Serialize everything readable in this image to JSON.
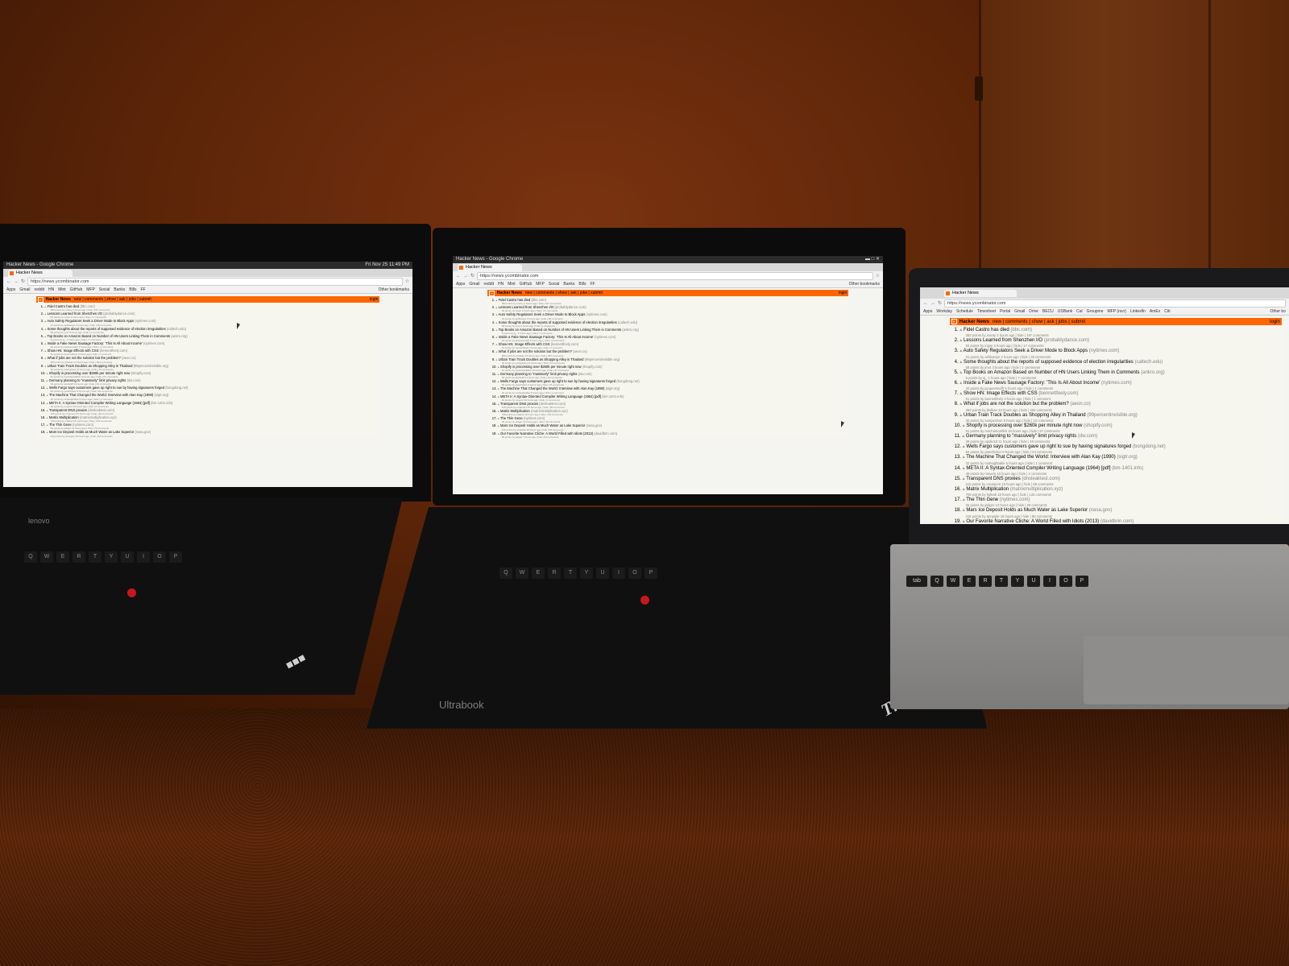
{
  "left_laptop": {
    "os_title": "Hacker News - Google Chrome",
    "os_clock": "Fri Nov 25 11:49 PM",
    "tab_title": "Hacker News",
    "url": "https://news.ycombinator.com",
    "bookmarks": [
      "Apps",
      "Gmail",
      "reddit",
      "HN",
      "Mint",
      "GitHub",
      "MFP",
      "Social",
      "Banks",
      "Bills",
      "FF"
    ],
    "other_bookmarks": "Other bookmarks",
    "brand": "lenovo"
  },
  "center_laptop": {
    "os_title": "Hacker News - Google Chrome",
    "tab_title": "Hacker News",
    "url": "https://news.ycombinator.com",
    "bookmarks": [
      "Apps",
      "Gmail",
      "reddit",
      "HN",
      "Mint",
      "GitHub",
      "MFP",
      "Social",
      "Banks",
      "Bills",
      "FF"
    ],
    "other_bookmarks": "Other bookmarks",
    "brand_badge": "Ultrabook",
    "logo": "ThinkPad"
  },
  "right_laptop": {
    "tab_title": "Hacker News",
    "url": "https://news.ycombinator.com",
    "bookmarks": [
      "Apps",
      "Workday",
      "Schedule",
      "Timesheet",
      "Portal",
      "Gmail",
      "Drive",
      "BECU",
      "USBank",
      "Cal",
      "Groupme",
      "MFP (rsvr)",
      "LinkedIn",
      "AmEx",
      "Citi"
    ],
    "other_bookmarks": "Other bo"
  },
  "hn": {
    "title": "Hacker News",
    "nav": "new | comments | show | ask | jobs | submit",
    "login": "login",
    "stories": [
      {
        "rank": "1.",
        "title": "Fidel Castro has died",
        "site": "(bbc.com)",
        "sub": "383 points by manty 2 hours ago | hide | 197 comments"
      },
      {
        "rank": "2.",
        "title": "Lessons Learned from Shenzhen I/O",
        "site": "(probablydance.com)",
        "sub": "93 points by ingve 3 hours ago | hide | 17 comments"
      },
      {
        "rank": "3.",
        "title": "Auto Safety Regulators Seek a Driver Mode to Block Apps",
        "site": "(nytimes.com)",
        "sub": "31 points by ashkaniye 3 hours ago | hide | 38 comments"
      },
      {
        "rank": "4.",
        "title": "Some thoughts about the reports of supposed evidence of election irregularities",
        "site": "(caltech.edu)",
        "sub": "58 points by jmut 3 hours ago | hide | 2 comments"
      },
      {
        "rank": "5.",
        "title": "Top Books on Amazon Based on Number of HN Users Linking Them in Comments",
        "site": "(ankro.org)",
        "sub": "5 points by sj_ 1 hours ago | hide | 7 comments"
      },
      {
        "rank": "6.",
        "title": "Inside a Fake News Sausage Factory: 'This Is All About Income'",
        "site": "(nytimes.com)",
        "sub": "32 points by jacquesmaffr 5 hours ago | hide | 4 comments"
      },
      {
        "rank": "7.",
        "title": "Show HN: Image Effects with CSS",
        "site": "(bennettfeely.com)",
        "sub": "51 points by bennettfeely 3 hours ago | hide | 1 comment"
      },
      {
        "rank": "8.",
        "title": "What if jobs are not the solution but the problem?",
        "site": "(aeon.co)",
        "sub": "383 points by jbelkan 13 hours ago | hide | 484 comments"
      },
      {
        "rank": "9.",
        "title": "Urban Train Track Doubles as Shopping Alley in Thailand",
        "site": "(99percentinvisible.org)",
        "sub": "30 points by samjackson 8 hours ago | hide | 10 comments"
      },
      {
        "rank": "10.",
        "title": "Shopify is processing over $260k per minute right now",
        "site": "(shopify.com)",
        "sub": "81 points by mechanicalfish 10 hours ago | hide | 57 comments"
      },
      {
        "rank": "11.",
        "title": "Germany planning to \"massively\" limit privacy rights",
        "site": "(dw.com)",
        "sub": "39 points by apollo18 11 hours ago | hide | 49 comments"
      },
      {
        "rank": "12.",
        "title": "Wells Fargo says customers gave up right to sue by having signatures forged",
        "site": "(bongdong.net)",
        "sub": "84 points by peterhicker 9 hours ago | hide | 24 comments"
      },
      {
        "rank": "13.",
        "title": "The Machine That Changed the World: Interview with Alan Kay (1990)",
        "site": "(sigtr.org)",
        "sub": "32 points by mobeightable 5 hours ago | hide | 1 comment"
      },
      {
        "rank": "14.",
        "title": "META II: A Syntax-Oriented Compiler Writing Language (1964) [pdf]",
        "site": "(bm-1401.info)",
        "sub": "49 points by meyers 10 hours ago | hide | 2 comments"
      },
      {
        "rank": "15.",
        "title": "Transparent DNS proxies",
        "site": "(dnsleaktest.com)",
        "sub": "115 points by ornament 15 hours ago | hide | 68 comments"
      },
      {
        "rank": "16.",
        "title": "Matrix Multiplication",
        "site": "(matrixmultiplication.xyz)",
        "sub": "708 points by haltedi 18 hours ago | hide | 133 comments"
      },
      {
        "rank": "17.",
        "title": "The Thin Gene",
        "site": "(nytimes.com)",
        "sub": "35 points by jwilger 13 hours ago | hide | 29 comments"
      },
      {
        "rank": "18.",
        "title": "Mars Ice Deposit Holds as Much Water as Lake Superior",
        "site": "(nasa.gov)",
        "sub": "316 points by annpiple 18 hours ago | hide | 99 comments"
      },
      {
        "rank": "19.",
        "title": "Our Favorite Narrative Cliche: A World Filled with Idiots (2013)",
        "site": "(davidbrin.com)",
        "sub": "65 points by jwilger 7 hours ago | hide | 53 comments"
      }
    ]
  },
  "keyboard_labels": [
    "Q",
    "W",
    "E",
    "R",
    "T",
    "Y",
    "U",
    "I",
    "O",
    "P"
  ],
  "mac_labels": [
    "tab",
    "Q",
    "W",
    "E",
    "R",
    "T",
    "Y",
    "U",
    "I",
    "O",
    "P"
  ]
}
